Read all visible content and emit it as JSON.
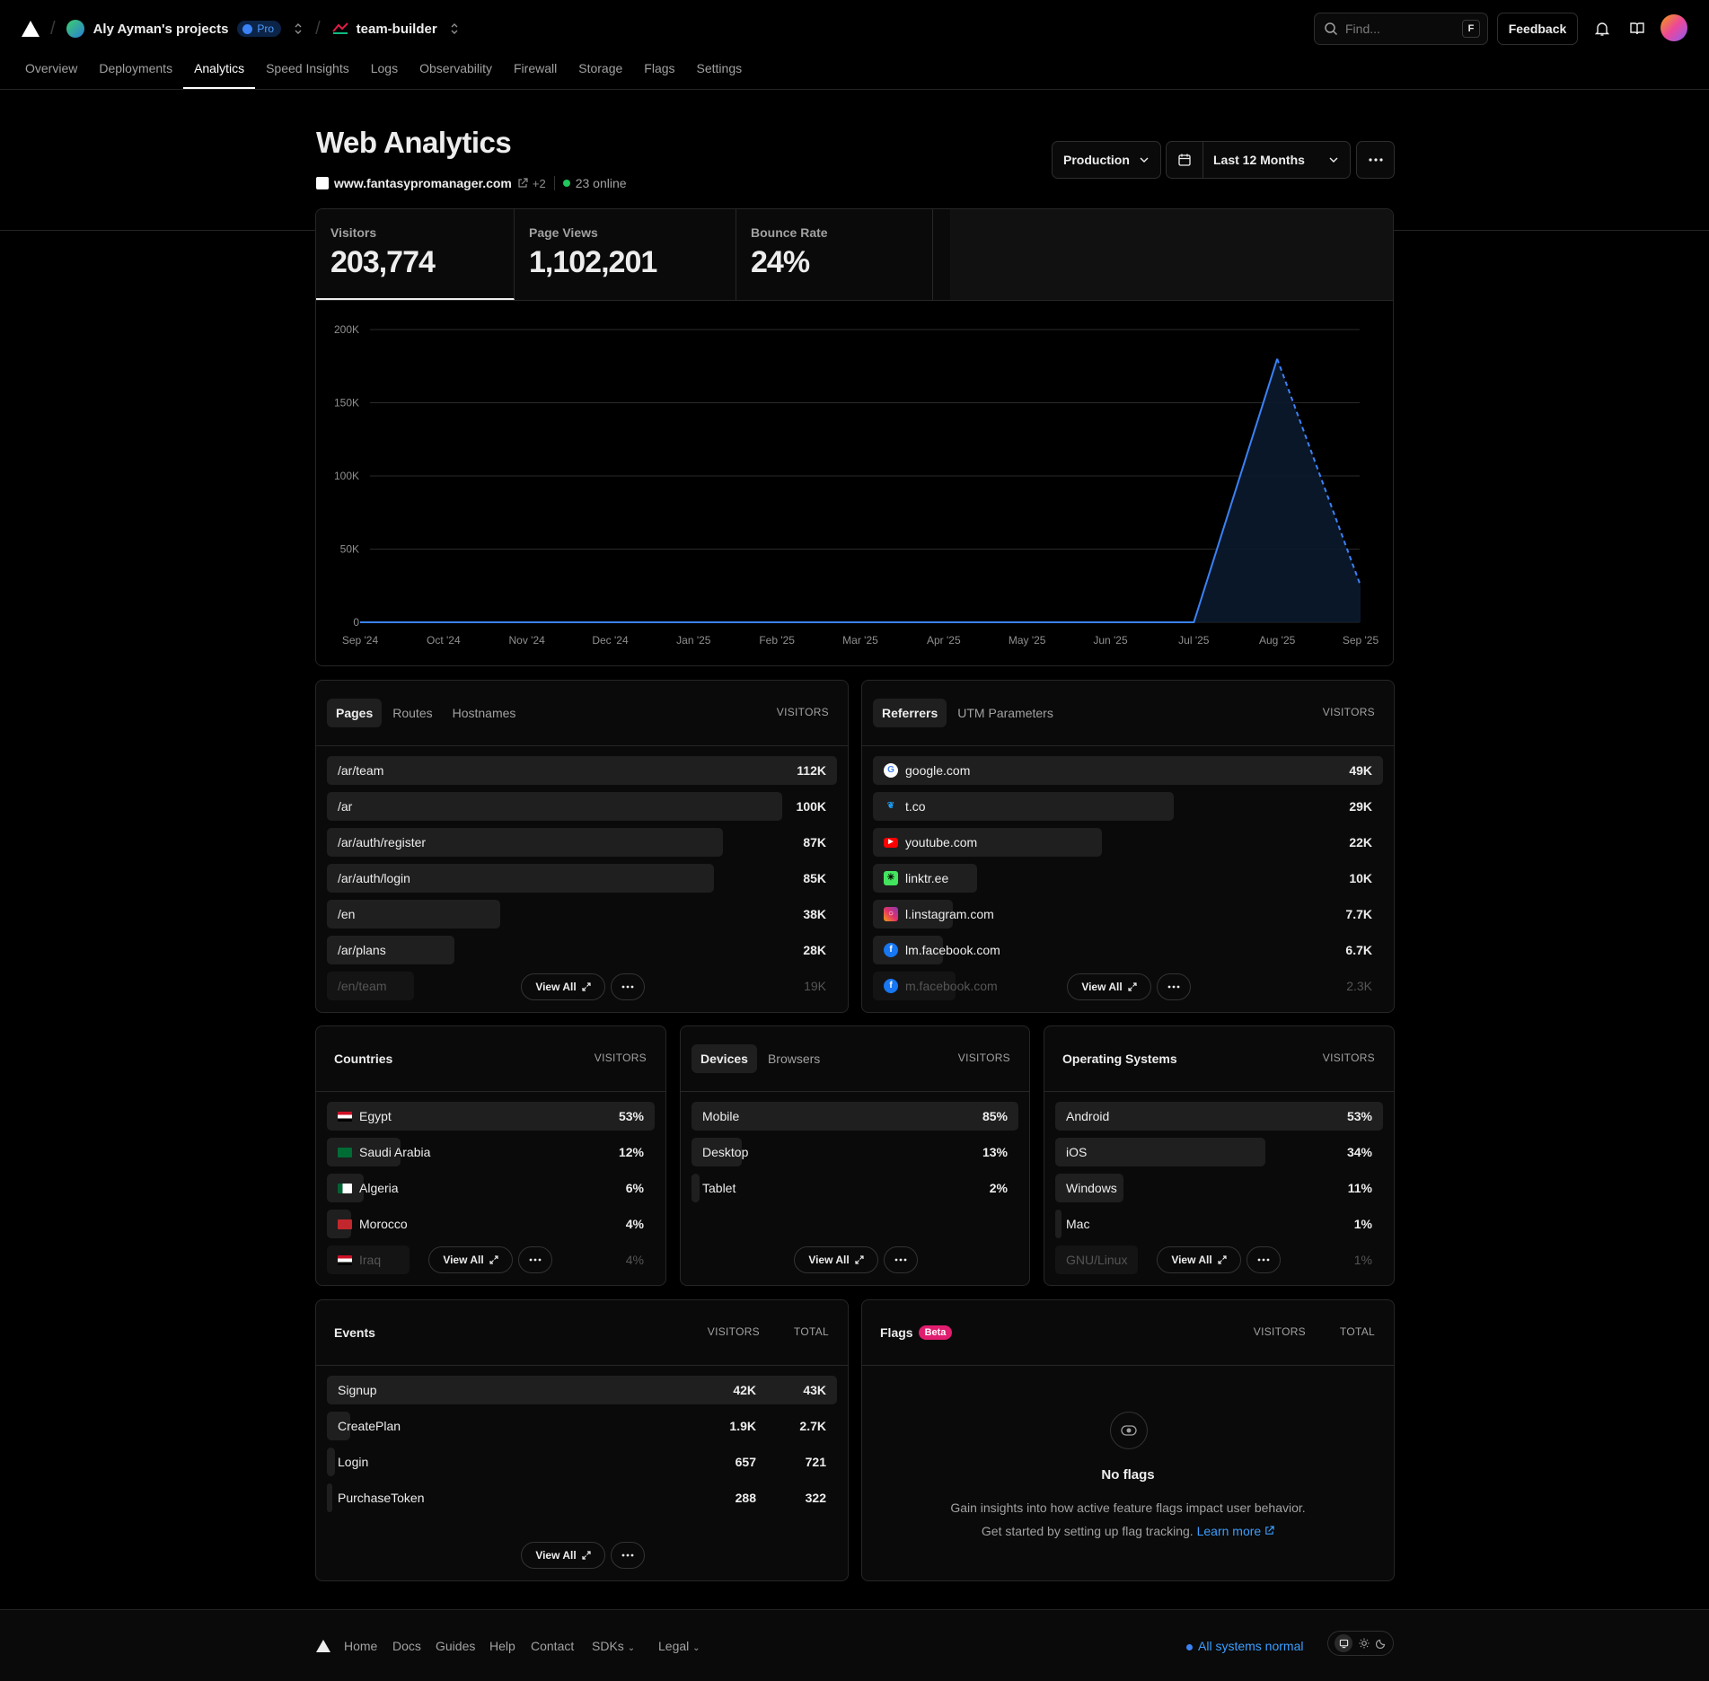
{
  "topbar": {
    "project": "Aly Ayman's projects",
    "plan_badge": "Pro",
    "team": "team-builder",
    "search_placeholder": "Find...",
    "search_shortcut": "F",
    "feedback_label": "Feedback"
  },
  "nav": [
    "Overview",
    "Deployments",
    "Analytics",
    "Speed Insights",
    "Logs",
    "Observability",
    "Firewall",
    "Storage",
    "Flags",
    "Settings"
  ],
  "nav_active": "Analytics",
  "page": {
    "title": "Web Analytics",
    "site": "www.fantasypromanager.com",
    "extra_domains": "+2",
    "online": "23 online",
    "environment": "Production",
    "range": "Last 12 Months"
  },
  "metrics": [
    {
      "label": "Visitors",
      "value": "203,774"
    },
    {
      "label": "Page Views",
      "value": "1,102,201"
    },
    {
      "label": "Bounce Rate",
      "value": "24%"
    }
  ],
  "chart_data": {
    "type": "area",
    "x": [
      "Sep '24",
      "Oct '24",
      "Nov '24",
      "Dec '24",
      "Jan '25",
      "Feb '25",
      "Mar '25",
      "Apr '25",
      "May '25",
      "Jun '25",
      "Jul '25",
      "Aug '25",
      "Sep '25"
    ],
    "values": [
      0,
      0,
      0,
      0,
      0,
      0,
      0,
      0,
      0,
      0,
      0,
      180000,
      25000
    ],
    "yticks": [
      "200K",
      "150K",
      "100K",
      "50K",
      "0"
    ],
    "ylim": [
      0,
      200000
    ],
    "grid": true,
    "incomplete_last_segment": "dashed",
    "color": "#3b82f6"
  },
  "pages_card": {
    "tabs": [
      "Pages",
      "Routes",
      "Hostnames"
    ],
    "column": "VISITORS",
    "rows": [
      {
        "label": "/ar/team",
        "value": "112K",
        "share": 1.0
      },
      {
        "label": "/ar",
        "value": "100K",
        "share": 0.893
      },
      {
        "label": "/ar/auth/register",
        "value": "87K",
        "share": 0.777
      },
      {
        "label": "/ar/auth/login",
        "value": "85K",
        "share": 0.759
      },
      {
        "label": "/en",
        "value": "38K",
        "share": 0.339
      },
      {
        "label": "/ar/plans",
        "value": "28K",
        "share": 0.25
      },
      {
        "label": "/en/team",
        "value": "19K",
        "share": 0.17
      }
    ],
    "view_all": "View All"
  },
  "referrers_card": {
    "tabs": [
      "Referrers",
      "UTM Parameters"
    ],
    "column": "VISITORS",
    "rows": [
      {
        "label": "google.com",
        "value": "49K",
        "share": 1.0,
        "icon": "google-icon",
        "color": "#ffffff"
      },
      {
        "label": "t.co",
        "value": "29K",
        "share": 0.59,
        "icon": "twitter-icon",
        "color": "#1d9bf0"
      },
      {
        "label": "youtube.com",
        "value": "22K",
        "share": 0.449,
        "icon": "youtube-icon",
        "color": "#ff0000"
      },
      {
        "label": "linktr.ee",
        "value": "10K",
        "share": 0.204,
        "icon": "linktree-icon",
        "color": "#43e55e"
      },
      {
        "label": "l.instagram.com",
        "value": "7.7K",
        "share": 0.157,
        "icon": "instagram-icon",
        "color": "#e1306c"
      },
      {
        "label": "lm.facebook.com",
        "value": "6.7K",
        "share": 0.137,
        "icon": "facebook-icon",
        "color": "#1877f2"
      },
      {
        "label": "m.facebook.com",
        "value": "2.3K",
        "share": 0.047,
        "icon": "facebook-icon",
        "color": "#1877f2"
      }
    ],
    "view_all": "View All"
  },
  "countries_card": {
    "title": "Countries",
    "column": "VISITORS",
    "rows": [
      {
        "label": "Egypt",
        "value": "53%",
        "share": 1.0
      },
      {
        "label": "Saudi Arabia",
        "value": "12%",
        "share": 0.226
      },
      {
        "label": "Algeria",
        "value": "6%",
        "share": 0.113
      },
      {
        "label": "Morocco",
        "value": "4%",
        "share": 0.075
      },
      {
        "label": "Iraq",
        "value": "4%",
        "share": 0.075
      }
    ],
    "view_all": "View All"
  },
  "devices_card": {
    "tabs": [
      "Devices",
      "Browsers"
    ],
    "column": "VISITORS",
    "rows": [
      {
        "label": "Mobile",
        "value": "85%",
        "share": 1.0
      },
      {
        "label": "Desktop",
        "value": "13%",
        "share": 0.153
      },
      {
        "label": "Tablet",
        "value": "2%",
        "share": 0.024
      }
    ],
    "view_all": "View All"
  },
  "os_card": {
    "title": "Operating Systems",
    "column": "VISITORS",
    "rows": [
      {
        "label": "Android",
        "value": "53%",
        "share": 1.0
      },
      {
        "label": "iOS",
        "value": "34%",
        "share": 0.642
      },
      {
        "label": "Windows",
        "value": "11%",
        "share": 0.208
      },
      {
        "label": "Mac",
        "value": "1%",
        "share": 0.019
      },
      {
        "label": "GNU/Linux",
        "value": "1%",
        "share": 0.019
      }
    ],
    "view_all": "View All"
  },
  "events_card": {
    "title": "Events",
    "columns": [
      "VISITORS",
      "TOTAL"
    ],
    "rows": [
      {
        "label": "Signup",
        "visitors": "42K",
        "total": "43K",
        "share": 1.0
      },
      {
        "label": "CreatePlan",
        "visitors": "1.9K",
        "total": "2.7K",
        "share": 0.045
      },
      {
        "label": "Login",
        "visitors": "657",
        "total": "721",
        "share": 0.016
      },
      {
        "label": "PurchaseToken",
        "visitors": "288",
        "total": "322",
        "share": 0.007
      }
    ],
    "view_all": "View All"
  },
  "flags_card": {
    "title": "Flags",
    "badge": "Beta",
    "columns": [
      "VISITORS",
      "TOTAL"
    ],
    "empty_title": "No flags",
    "empty_line1": "Gain insights into how active feature flags impact user behavior.",
    "empty_line2": "Get started by setting up flag tracking.",
    "learn_more": "Learn more"
  },
  "footer": {
    "links": [
      "Home",
      "Docs",
      "Guides",
      "Help",
      "Contact",
      "SDKs",
      "Legal"
    ],
    "status": "All systems normal"
  }
}
